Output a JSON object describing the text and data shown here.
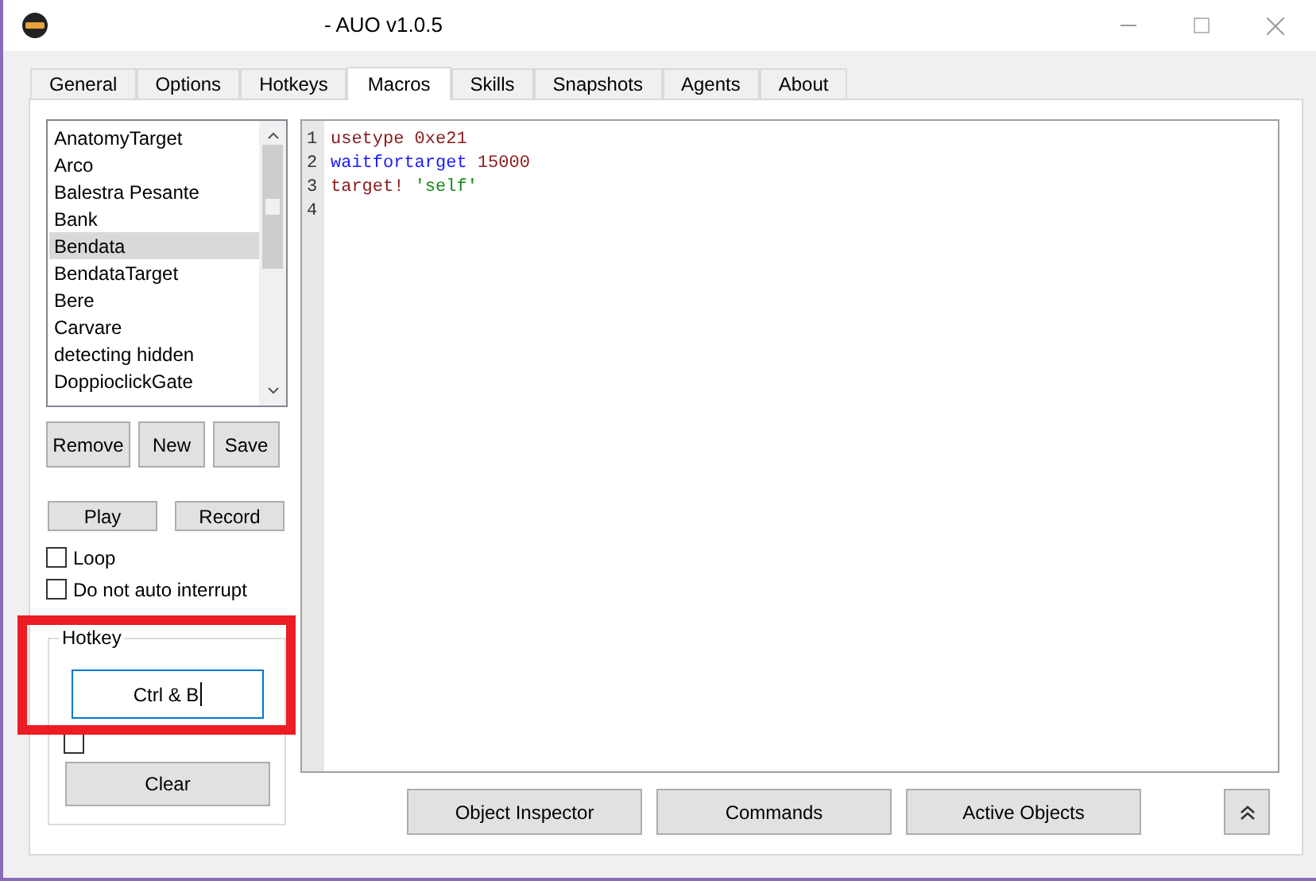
{
  "window": {
    "title": "- AUO v1.0.5"
  },
  "tabs": [
    {
      "label": "General",
      "selected": false
    },
    {
      "label": "Options",
      "selected": false
    },
    {
      "label": "Hotkeys",
      "selected": false
    },
    {
      "label": "Macros",
      "selected": true
    },
    {
      "label": "Skills",
      "selected": false
    },
    {
      "label": "Snapshots",
      "selected": false
    },
    {
      "label": "Agents",
      "selected": false
    },
    {
      "label": "About",
      "selected": false
    }
  ],
  "macro_list": [
    {
      "label": "AnatomyTarget",
      "selected": false
    },
    {
      "label": "Arco",
      "selected": false
    },
    {
      "label": "Balestra Pesante",
      "selected": false
    },
    {
      "label": "Bank",
      "selected": false
    },
    {
      "label": "Bendata",
      "selected": true
    },
    {
      "label": "BendataTarget",
      "selected": false
    },
    {
      "label": "Bere",
      "selected": false
    },
    {
      "label": "Carvare",
      "selected": false
    },
    {
      "label": "detecting hidden",
      "selected": false
    },
    {
      "label": "DoppioclickGate",
      "selected": false
    }
  ],
  "list_buttons": [
    "Remove",
    "New",
    "Save"
  ],
  "play_buttons": [
    "Play",
    "Record"
  ],
  "options": [
    {
      "label": "Loop",
      "checked": false
    },
    {
      "label": "Do not auto interrupt",
      "checked": false
    }
  ],
  "hotkey": {
    "title": "Hotkey",
    "value": "Ctrl & B",
    "checkbox_checked": false,
    "clear_button": "Clear",
    "highlighted": true
  },
  "editor": {
    "lines": [
      {
        "number": "1",
        "tokens": [
          {
            "text": "usetype 0xe21",
            "kind": "command"
          }
        ]
      },
      {
        "number": "2",
        "tokens": [
          {
            "text": "waitfortarget",
            "kind": "keyword"
          },
          {
            "text": " 15000",
            "kind": "command"
          }
        ]
      },
      {
        "number": "3",
        "tokens": [
          {
            "text": "target! ",
            "kind": "command"
          },
          {
            "text": "'self'",
            "kind": "string"
          }
        ]
      },
      {
        "number": "4"
      }
    ]
  },
  "bottom_buttons": [
    "Object Inspector",
    "Commands",
    "Active Objects"
  ]
}
